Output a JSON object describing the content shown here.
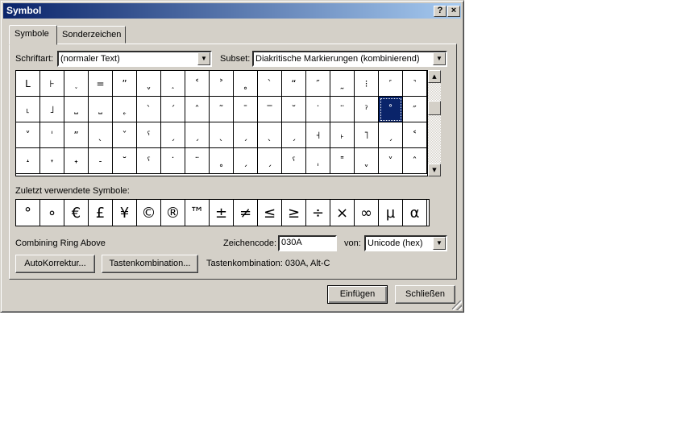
{
  "window": {
    "title": "Symbol",
    "help_label": "?",
    "close_label": "×"
  },
  "tabs": [
    {
      "label": "Symbole",
      "active": true
    },
    {
      "label": "Sonderzeichen",
      "active": false
    }
  ],
  "font": {
    "label": "Schriftart:",
    "value": "(normaler Text)"
  },
  "subset": {
    "label": "Subset:",
    "value": "Diakritische Markierungen (kombinierend)"
  },
  "grid": {
    "rows": [
      [
        "L",
        "⊦",
        "˯",
        "=",
        "”",
        "ˬ",
        "˰",
        "˂",
        "˃",
        "˳",
        "ˋ",
        "“",
        "″",
        "˷",
        "⁝",
        "˹",
        "˺"
      ],
      [
        "˪",
        "˩",
        "⎵",
        "⎵",
        "˿",
        "ˋ",
        "ˊ",
        "ˆ",
        "˜",
        "¯",
        "‾",
        "˘",
        "˙",
        "¨",
        "ˀ",
        "˚",
        "″"
      ],
      [
        "˅",
        "ˈ",
        "ˮ",
        "ˎ",
        "ˇ",
        "ˁ",
        "ˏ",
        "ˏ",
        "ˎ",
        "ˏ",
        "ˎ",
        "ˏ",
        "˧",
        "˫",
        "˥",
        "ˏ",
        "˂"
      ],
      [
        "˔",
        "˕",
        "˖",
        "˗",
        "˘",
        "ˁ",
        "˙",
        "¨",
        "˳",
        "ˏ",
        "ˏ",
        "ˁ",
        "ˌ",
        "˭",
        "ˬ",
        "˅",
        "ˆ"
      ]
    ],
    "selected": "˚"
  },
  "recent": {
    "label": "Zuletzt verwendete Symbole:",
    "symbols": [
      "°",
      "∘",
      "€",
      "£",
      "¥",
      "©",
      "®",
      "™",
      "±",
      "≠",
      "≤",
      "≥",
      "÷",
      "×",
      "∞",
      "µ",
      "α"
    ]
  },
  "char_name": "Combining Ring Above",
  "zeichencode": {
    "label": "Zeichencode:",
    "value": "030A"
  },
  "von": {
    "label": "von:",
    "value": "Unicode (hex)"
  },
  "buttons": {
    "autokorrektur": "AutoKorrektur...",
    "tastenkombination": "Tastenkombination...",
    "einfuegen": "Einfügen",
    "schliessen": "Schließen"
  },
  "shortcut_text": "Tastenkombination: 030A, Alt-C",
  "colors": {
    "title_start": "#0a246a",
    "title_end": "#a6caf0",
    "selection": "#0a246a",
    "face": "#d4d0c8"
  }
}
